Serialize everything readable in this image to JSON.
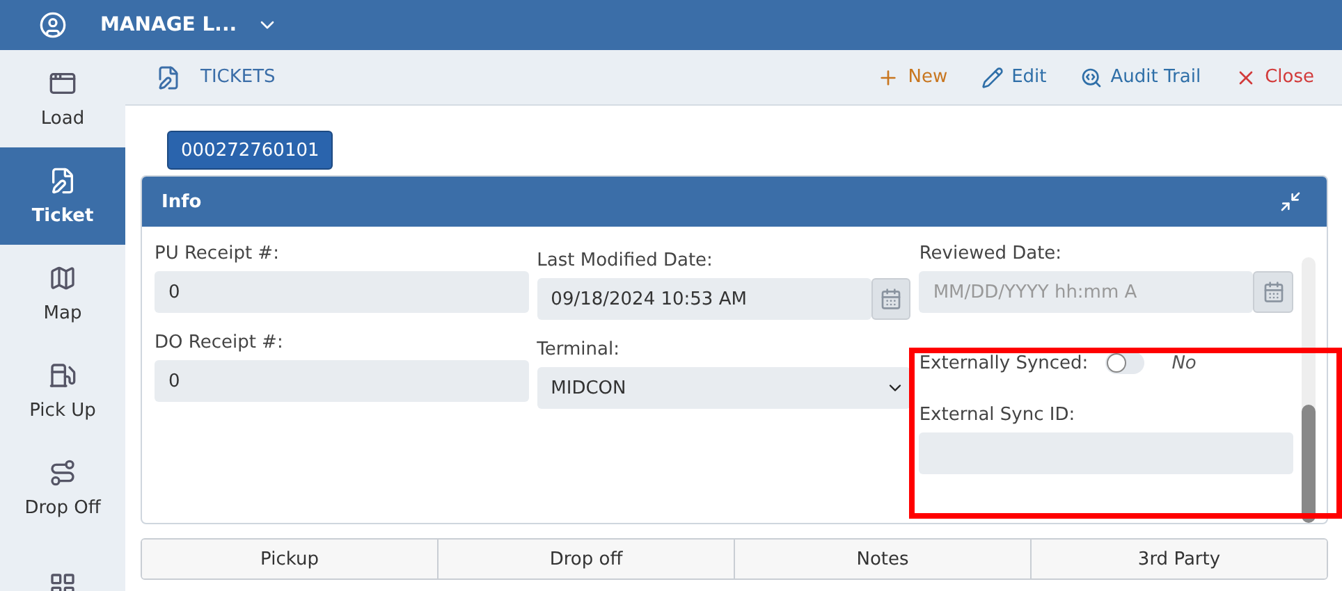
{
  "app_bar": {
    "title": "MANAGE L..."
  },
  "sidebar": {
    "items": [
      {
        "label": "Load",
        "selected": false
      },
      {
        "label": "Ticket",
        "selected": true
      },
      {
        "label": "Map",
        "selected": false
      },
      {
        "label": "Pick Up",
        "selected": false
      },
      {
        "label": "Drop Off",
        "selected": false
      },
      {
        "selected": false
      }
    ]
  },
  "header": {
    "title": "TICKETS",
    "actions": [
      {
        "kind": "new",
        "label": "New"
      },
      {
        "kind": "edit",
        "label": "Edit"
      },
      {
        "kind": "audit",
        "label": "Audit Trail"
      },
      {
        "kind": "close",
        "label": "Close"
      }
    ]
  },
  "ticket_number": "000272760101",
  "panel": {
    "title": "Info",
    "columns": [
      [
        {
          "kind": "text",
          "label": "PU Receipt #:",
          "value": "0"
        },
        {
          "kind": "text",
          "label": "DO Receipt #:",
          "value": "0"
        }
      ],
      [
        {
          "kind": "date",
          "label": "Last Modified Date:",
          "value": "09/18/2024 10:53 AM"
        },
        {
          "kind": "select",
          "label": "Terminal:",
          "value": "MIDCON"
        }
      ],
      [
        {
          "kind": "date",
          "label": "Reviewed Date:",
          "placeholder": "MM/DD/YYYY hh:mm A"
        },
        {
          "kind": "toggle",
          "label": "Externally Synced:",
          "on": false,
          "value_text": "No"
        },
        {
          "kind": "text",
          "label": "External Sync ID:"
        }
      ]
    ]
  },
  "tabs": [
    {
      "label": "Pickup"
    },
    {
      "label": "Drop off"
    },
    {
      "label": "Notes"
    },
    {
      "label": "3rd Party"
    }
  ]
}
